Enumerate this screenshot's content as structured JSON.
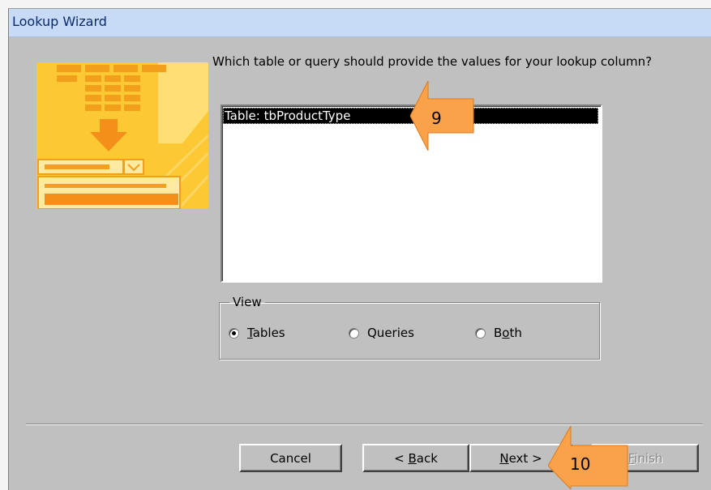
{
  "window": {
    "title": "Lookup Wizard"
  },
  "prompt": "Which table or query should provide the values for your lookup column?",
  "list": {
    "items": [
      "Table: tbProductType"
    ]
  },
  "view_group": {
    "legend": "View",
    "options": [
      {
        "label": "Tables",
        "selected": true
      },
      {
        "label": "Queries",
        "selected": false
      },
      {
        "label": "Both",
        "selected": false
      }
    ]
  },
  "buttons": {
    "cancel": "Cancel",
    "back": "< Back",
    "next": "Next >",
    "finish": "Finish"
  },
  "callouts": {
    "first": "9",
    "second": "10"
  },
  "colors": {
    "callout": "#f9a24a",
    "callout_edge": "#e07a1d",
    "art": "#fbc02d"
  }
}
